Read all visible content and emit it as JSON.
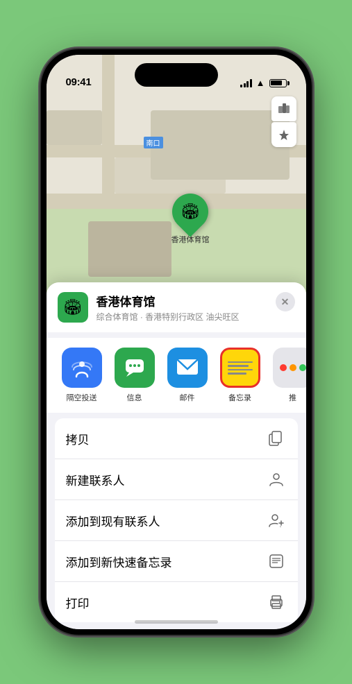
{
  "status_bar": {
    "time": "09:41",
    "location_arrow": "▶"
  },
  "map": {
    "label_box": "南口",
    "control_map": "🗺",
    "control_location": "➤",
    "pin_emoji": "🏟",
    "pin_label": "香港体育馆"
  },
  "sheet": {
    "close_label": "✕",
    "venue_emoji": "🏟",
    "venue_name": "香港体育馆",
    "venue_desc": "综合体育馆 · 香港特别行政区 油尖旺区"
  },
  "share_items": [
    {
      "id": "airdrop",
      "label": "隔空投送"
    },
    {
      "id": "messages",
      "label": "信息"
    },
    {
      "id": "mail",
      "label": "邮件"
    },
    {
      "id": "notes",
      "label": "备忘录"
    },
    {
      "id": "more",
      "label": "推"
    }
  ],
  "action_items": [
    {
      "label": "拷贝",
      "icon": "copy"
    },
    {
      "label": "新建联系人",
      "icon": "person"
    },
    {
      "label": "添加到现有联系人",
      "icon": "person-add"
    },
    {
      "label": "添加到新快速备忘录",
      "icon": "note"
    },
    {
      "label": "打印",
      "icon": "print"
    }
  ],
  "more_dots": {
    "colors": [
      "#ff3b30",
      "#ff9500",
      "#34c759",
      "#007aff",
      "#5856d6"
    ]
  }
}
